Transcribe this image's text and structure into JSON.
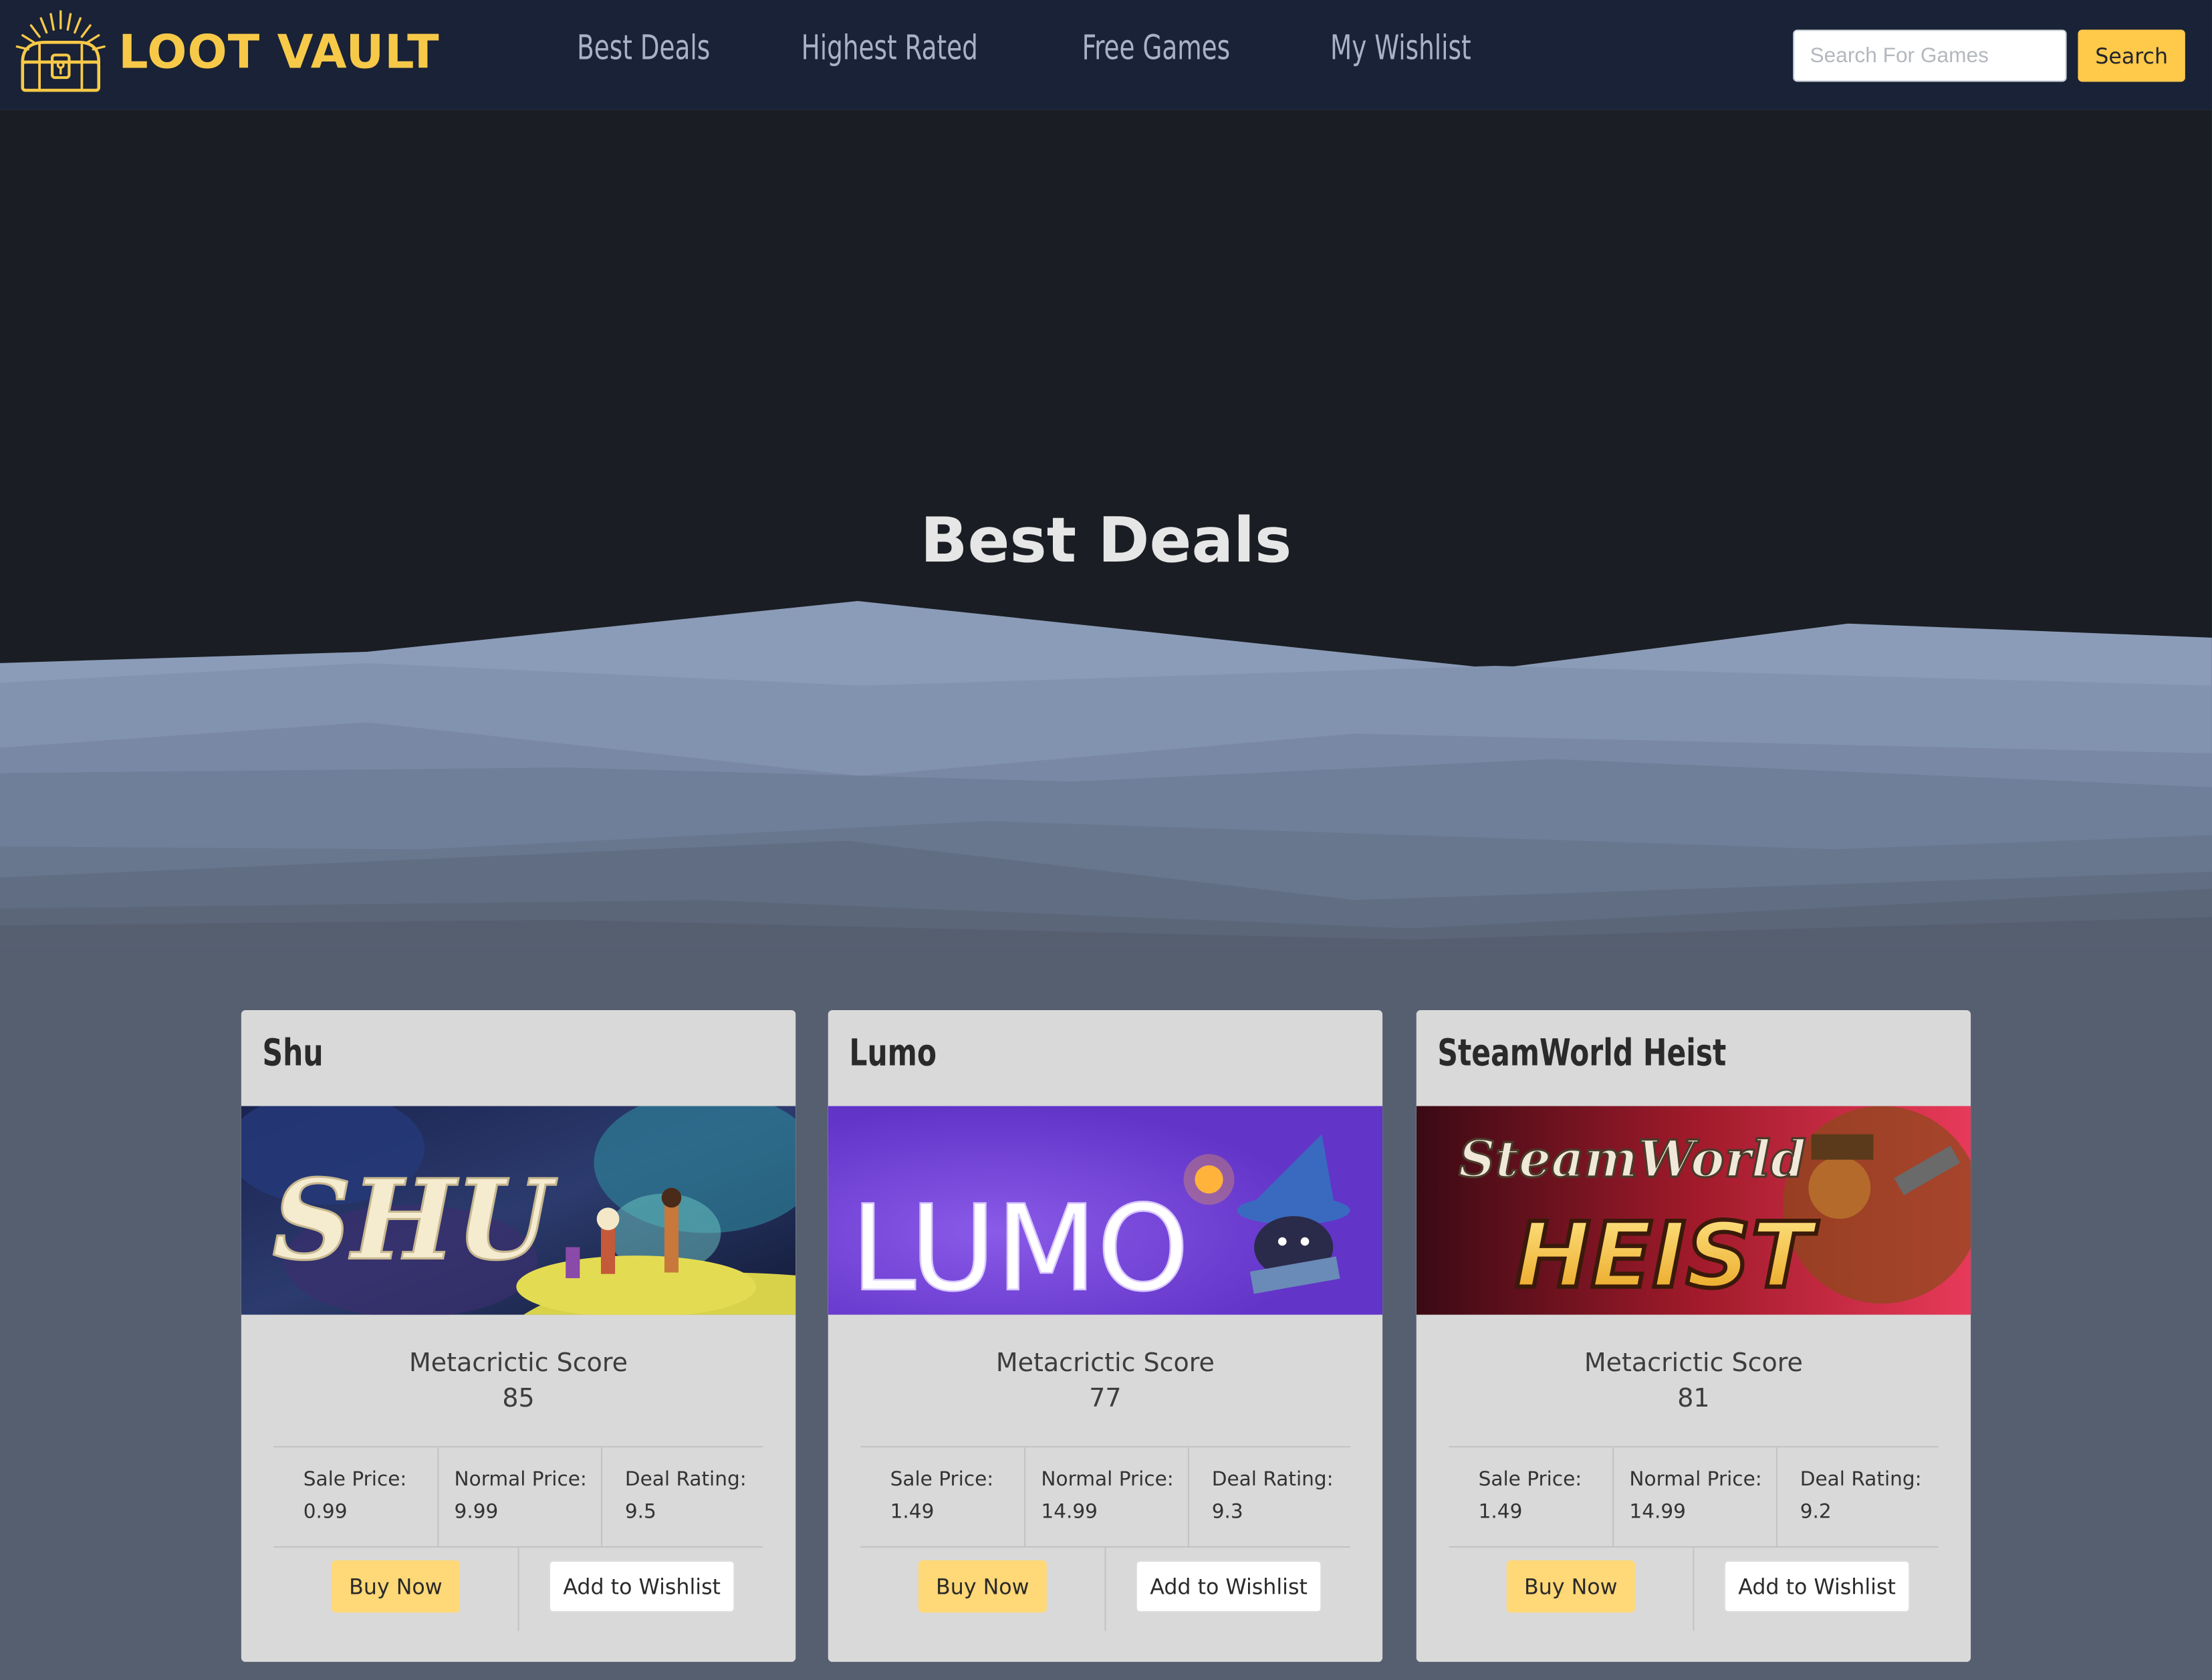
{
  "brand": {
    "name": "LOOT VAULT",
    "logo_icon": "treasure-chest-icon"
  },
  "nav": {
    "links": [
      {
        "label": "Best Deals"
      },
      {
        "label": "Highest Rated"
      },
      {
        "label": "Free Games"
      },
      {
        "label": "My Wishlist"
      }
    ]
  },
  "search": {
    "placeholder": "Search For Games",
    "value": "",
    "button_label": "Search"
  },
  "hero": {
    "title": "Best Deals"
  },
  "colors": {
    "nav_bg": "#192236",
    "brand_accent": "#f7c948",
    "hero_bg": "#1a1d23",
    "page_bg": "#565f70",
    "card_bg": "#d9d9d9",
    "buy_button": "#ffd877",
    "search_button": "#ffc94a"
  },
  "cards": [
    {
      "title": "Shu",
      "image_text": "SHU",
      "score_label": "Metacrictic Score",
      "score": "85",
      "sale_label": "Sale Price:",
      "sale": "0.99",
      "normal_label": "Normal Price:",
      "normal": "9.99",
      "rating_label": "Deal Rating:",
      "rating": "9.5",
      "buy_label": "Buy Now",
      "wishlist_label": "Add to Wishlist"
    },
    {
      "title": "Lumo",
      "image_text": "LUMO",
      "score_label": "Metacrictic Score",
      "score": "77",
      "sale_label": "Sale Price:",
      "sale": "1.49",
      "normal_label": "Normal Price:",
      "normal": "14.99",
      "rating_label": "Deal Rating:",
      "rating": "9.3",
      "buy_label": "Buy Now",
      "wishlist_label": "Add to Wishlist"
    },
    {
      "title": "SteamWorld Heist",
      "image_text": "HEIST",
      "image_text_secondary": "SteamWorld",
      "score_label": "Metacrictic Score",
      "score": "81",
      "sale_label": "Sale Price:",
      "sale": "1.49",
      "normal_label": "Normal Price:",
      "normal": "14.99",
      "rating_label": "Deal Rating:",
      "rating": "9.2",
      "buy_label": "Buy Now",
      "wishlist_label": "Add to Wishlist"
    }
  ]
}
